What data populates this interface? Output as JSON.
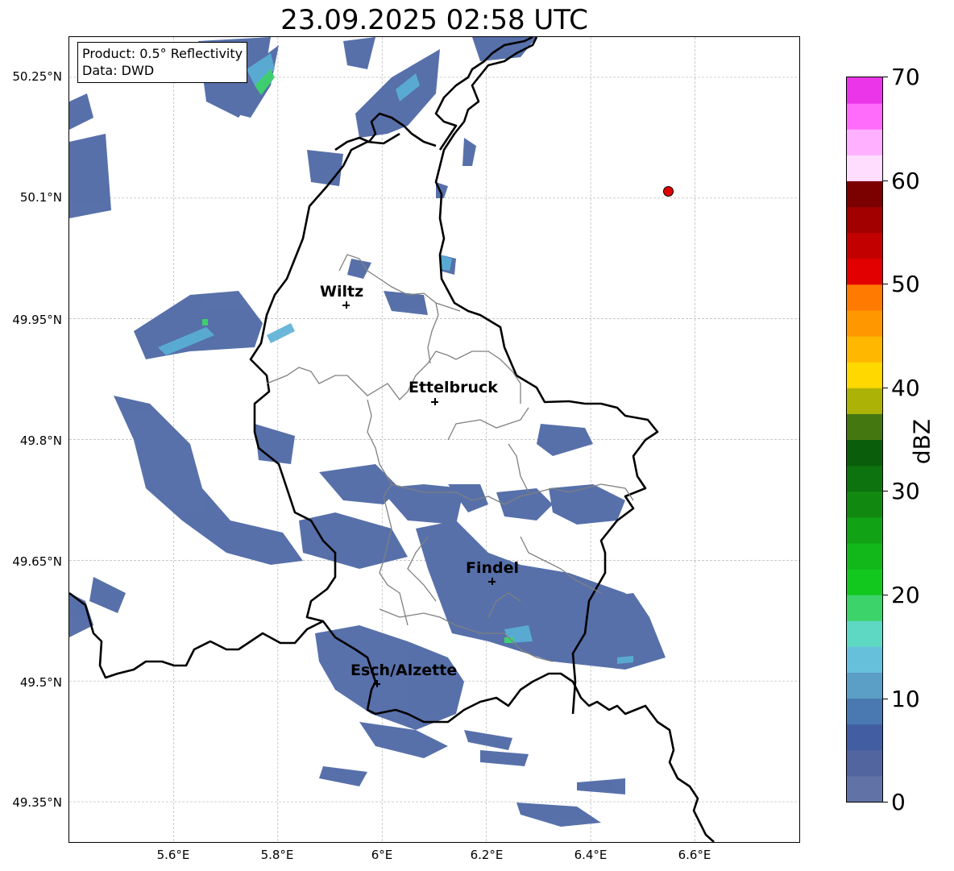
{
  "title": "23.09.2025 02:58 UTC",
  "info_box": {
    "product": "Product: 0.5° Reflectivity",
    "data_source": "Data: DWD"
  },
  "map": {
    "lat_range": [
      49.3,
      50.3
    ],
    "lon_range": [
      5.4,
      6.8
    ],
    "lat_ticks": [
      {
        "value": 50.25,
        "label": "50.25°N"
      },
      {
        "value": 50.1,
        "label": "50.1°N"
      },
      {
        "value": 49.95,
        "label": "49.95°N"
      },
      {
        "value": 49.8,
        "label": "49.8°N"
      },
      {
        "value": 49.65,
        "label": "49.65°N"
      },
      {
        "value": 49.5,
        "label": "49.5°N"
      },
      {
        "value": 49.35,
        "label": "49.35°N"
      }
    ],
    "lon_ticks": [
      {
        "value": 5.6,
        "label": "5.6°E"
      },
      {
        "value": 5.8,
        "label": "5.8°E"
      },
      {
        "value": 6.0,
        "label": "6°E"
      },
      {
        "value": 6.2,
        "label": "6.2°E"
      },
      {
        "value": 6.4,
        "label": "6.4°E"
      },
      {
        "value": 6.6,
        "label": "6.6°E"
      }
    ],
    "grid": true,
    "cities": [
      {
        "name": "Wiltz",
        "lat": 49.97,
        "lon": 5.93
      },
      {
        "name": "Ettelbruck",
        "lat": 49.85,
        "lon": 6.1
      },
      {
        "name": "Findel",
        "lat": 49.63,
        "lon": 6.21
      },
      {
        "name": "Esch/Alzette",
        "lat": 49.5,
        "lon": 5.98
      }
    ],
    "radar_station": {
      "lat": 50.11,
      "lon": 6.55,
      "color": "#e00000"
    }
  },
  "colorbar": {
    "unit": "dBZ",
    "min": 0,
    "max": 70,
    "step": 2.5,
    "tick_labels": [
      "0",
      "10",
      "20",
      "30",
      "40",
      "50",
      "60",
      "70"
    ],
    "colors": [
      "#6173a6",
      "#52659f",
      "#425da2",
      "#4a78b0",
      "#5b9ec6",
      "#66c0dc",
      "#5fd8c3",
      "#3dd36b",
      "#12c81f",
      "#12b71a",
      "#12a216",
      "#118911",
      "#0d730e",
      "#0a5e0b",
      "#457710",
      "#adb206",
      "#ffd800",
      "#ffb700",
      "#ff9800",
      "#ff7a00",
      "#e30000",
      "#c20000",
      "#a20000",
      "#7b0000",
      "#ffddff",
      "#ffb0ff",
      "#ff6bfa",
      "#ea35e9"
    ]
  },
  "legend_colors": {
    "radar_low": "#4f69a6",
    "radar_mid": "#5ab0d6",
    "radar_high": "#3dd36b"
  }
}
